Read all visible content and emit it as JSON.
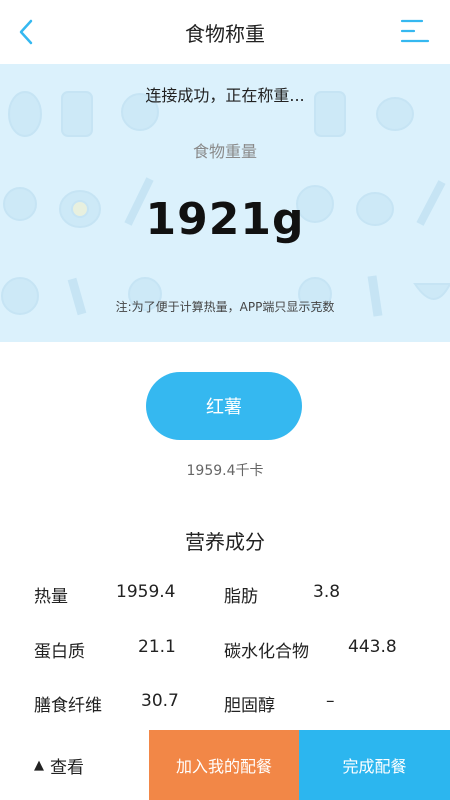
{
  "header": {
    "title": "食物称重",
    "back_icon": "chevron-left-icon",
    "menu_icon": "menu-icon",
    "accent_color": "#35b8f0"
  },
  "weigh": {
    "status": "连接成功，正在称重...",
    "label": "食物重量",
    "value": "1921g",
    "note": "注:为了便于计算热量，APP端只显示克数"
  },
  "food": {
    "name": "红薯",
    "kcal": "1959.4千卡"
  },
  "nutrition": {
    "title": "营养成分",
    "items": [
      {
        "label": "热量",
        "value": "1959.4"
      },
      {
        "label": "脂肪",
        "value": "3.8"
      },
      {
        "label": "蛋白质",
        "value": "21.1"
      },
      {
        "label": "碳水化合物",
        "value": "443.8"
      },
      {
        "label": "膳食纤维",
        "value": "30.7"
      },
      {
        "label": "胆固醇",
        "value": "–"
      }
    ]
  },
  "bottom": {
    "view_label": "查看",
    "add_label": "加入我的配餐",
    "done_label": "完成配餐",
    "add_color": "#f28747",
    "done_color": "#2cb6ef"
  }
}
